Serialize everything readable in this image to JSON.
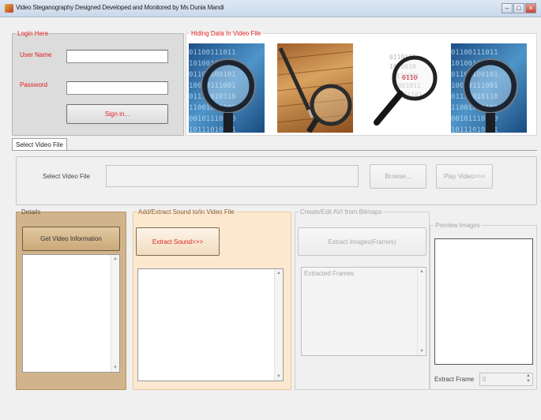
{
  "window": {
    "title": "Video Steganography Designed Developed and Monitored by Ms Dunia Mandi"
  },
  "login": {
    "legend": "Login Here",
    "username_label": "User Name",
    "password_label": "Password",
    "signin_label": "Sign in..."
  },
  "hiding": {
    "legend": "Hiding Data In Video File"
  },
  "tab": {
    "label": "Select Video File"
  },
  "select": {
    "label": "Select Video File",
    "browse_label": "Browse...",
    "play_label": "Play Video>>>"
  },
  "details": {
    "legend": "Details",
    "get_info_label": "Get Video Information"
  },
  "sound": {
    "legend": "Add/Extract Sound to/in Video File",
    "extract_label": "Extract Sound>>>"
  },
  "bitmaps": {
    "legend": "Create/Edit AVI from Bitmaps",
    "extract_images_label": "Extract Images(Frames)",
    "list_header": "Extracted Frames"
  },
  "preview": {
    "legend": "Preview Images",
    "frame_label": "Extract Frame",
    "frame_value": "0"
  },
  "colors": {
    "accent_red": "#e0201f",
    "details_bg": "#d2b48c",
    "sound_bg": "#fbe8cf"
  }
}
